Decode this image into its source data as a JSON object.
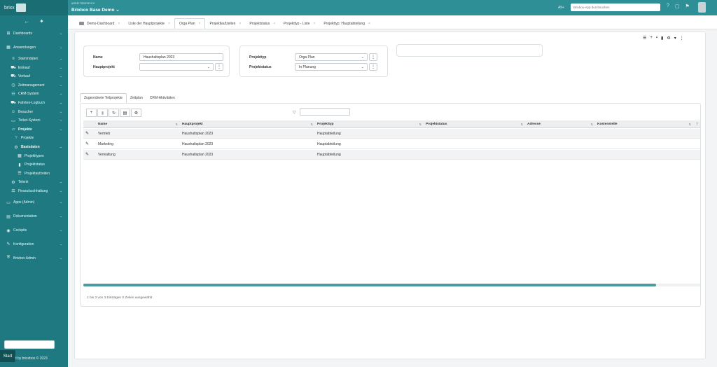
{
  "sidebar": {
    "logo_text": "brixx",
    "back_icon": "←",
    "pin_icon": "pin-icon",
    "items": [
      {
        "label": "Dashboards",
        "icon": "dashboard-icon",
        "level": 0,
        "chevron": true
      },
      {
        "label": "Anwendungen",
        "icon": "grid-icon",
        "level": 0,
        "chevron": true
      },
      {
        "label": "Stammdaten",
        "icon": "database-icon",
        "level": 1,
        "chevron": true
      },
      {
        "label": "Einkauf",
        "icon": "cart-icon",
        "level": 1,
        "chevron": true
      },
      {
        "label": "Verkauf",
        "icon": "truck-icon",
        "level": 1,
        "chevron": true
      },
      {
        "label": "Zeitmanagement",
        "icon": "clock-icon",
        "level": 1,
        "chevron": true
      },
      {
        "label": "CRM-System",
        "icon": "contacts-icon",
        "level": 1,
        "chevron": true
      },
      {
        "label": "Fahrten-Logbuch",
        "icon": "car-icon",
        "level": 1,
        "chevron": true
      },
      {
        "label": "Besucher",
        "icon": "visitor-icon",
        "level": 1,
        "chevron": true
      },
      {
        "label": "Ticket-System",
        "icon": "ticket-icon",
        "level": 1,
        "chevron": true
      },
      {
        "label": "Projekte",
        "icon": "folder-icon",
        "level": 1,
        "chevron": true,
        "bold": true
      },
      {
        "label": "Projekte",
        "icon": "branch-icon",
        "level": 2,
        "chevron": false
      },
      {
        "label": "Basisdaten",
        "icon": "gear-icon",
        "level": 2,
        "chevron": true,
        "bold": true
      },
      {
        "label": "Projekttypen",
        "icon": "table-icon",
        "level": 3,
        "chevron": false
      },
      {
        "label": "Projektstatus",
        "icon": "bars-icon",
        "level": 3,
        "chevron": false
      },
      {
        "label": "Projektaufzeiten",
        "icon": "list-icon",
        "level": 3,
        "chevron": false
      },
      {
        "label": "Telenk",
        "icon": "gear-icon",
        "level": 1,
        "chevron": true
      },
      {
        "label": "Finanzbuchhaltung",
        "icon": "balance-icon",
        "level": 1,
        "chevron": true
      },
      {
        "label": "Apps (Admin)",
        "icon": "apps-icon",
        "level": 0,
        "chevron": true
      },
      {
        "label": "Dokumentation",
        "icon": "book-icon",
        "level": 0,
        "chevron": true
      },
      {
        "label": "Cockpits",
        "icon": "cockpit-icon",
        "level": 0,
        "chevron": true
      },
      {
        "label": "Konfiguration",
        "icon": "wrench-icon",
        "level": 0,
        "chevron": true
      },
      {
        "label": "Brixbox Admin",
        "icon": "shield-icon",
        "level": 0,
        "chevron": true
      }
    ],
    "footer": "ed by brixxbox © 2023",
    "start_label": "Start"
  },
  "topbar": {
    "workspace_label": "ARBEITSBEREICH",
    "workspace_name": "Brixbox Base Demo ⌄",
    "alt_label": "Alt+",
    "search_placeholder": "Brixbox-App durchsuchen"
  },
  "tabs": [
    {
      "label": "Demo-Dashboard",
      "active": false
    },
    {
      "label": "Liste der Hauptprojekte",
      "active": false
    },
    {
      "label": "Orga Plan",
      "active": true
    },
    {
      "label": "Projektlaufzeiten",
      "active": false
    },
    {
      "label": "Projektstatus",
      "active": false
    },
    {
      "label": "Projekttyp - Liste",
      "active": false
    },
    {
      "label": "Projekttyp: Hauptabteilung",
      "active": false
    }
  ],
  "form": {
    "name_label": "Name",
    "name_value": "Haushaltsplan 2023",
    "hauptprojekt_label": "Hauptprojekt",
    "hauptprojekt_value": "",
    "projekttyp_label": "Projekttyp",
    "projekttyp_value": "Orga Plan",
    "projektstatus_label": "Projektstatus",
    "projektstatus_value": "In Planung"
  },
  "subtabs": [
    {
      "label": "Zugeordnete Teilprojekte",
      "active": true
    },
    {
      "label": "Zeitplan",
      "active": false
    },
    {
      "label": "CRM-Aktivitäten",
      "active": false
    }
  ],
  "grid": {
    "columns": [
      "Name",
      "Hauptprojekt",
      "Projekttyp",
      "Projektstatus",
      "Adresse",
      "Kostenstelle"
    ],
    "rows": [
      [
        "Vertrieb",
        "Haushaltsplan 2023",
        "Hauptabteilung",
        "",
        "",
        ""
      ],
      [
        "Marketing",
        "Haushaltsplan 2023",
        "Hauptabteilung",
        "",
        "",
        ""
      ],
      [
        "Verwaltung",
        "Haushaltsplan 2023",
        "Hauptabteilung",
        "",
        "",
        ""
      ]
    ],
    "footer": "1 bis 3 von 3 Einträgen    0 Zeilen ausgewählt"
  }
}
